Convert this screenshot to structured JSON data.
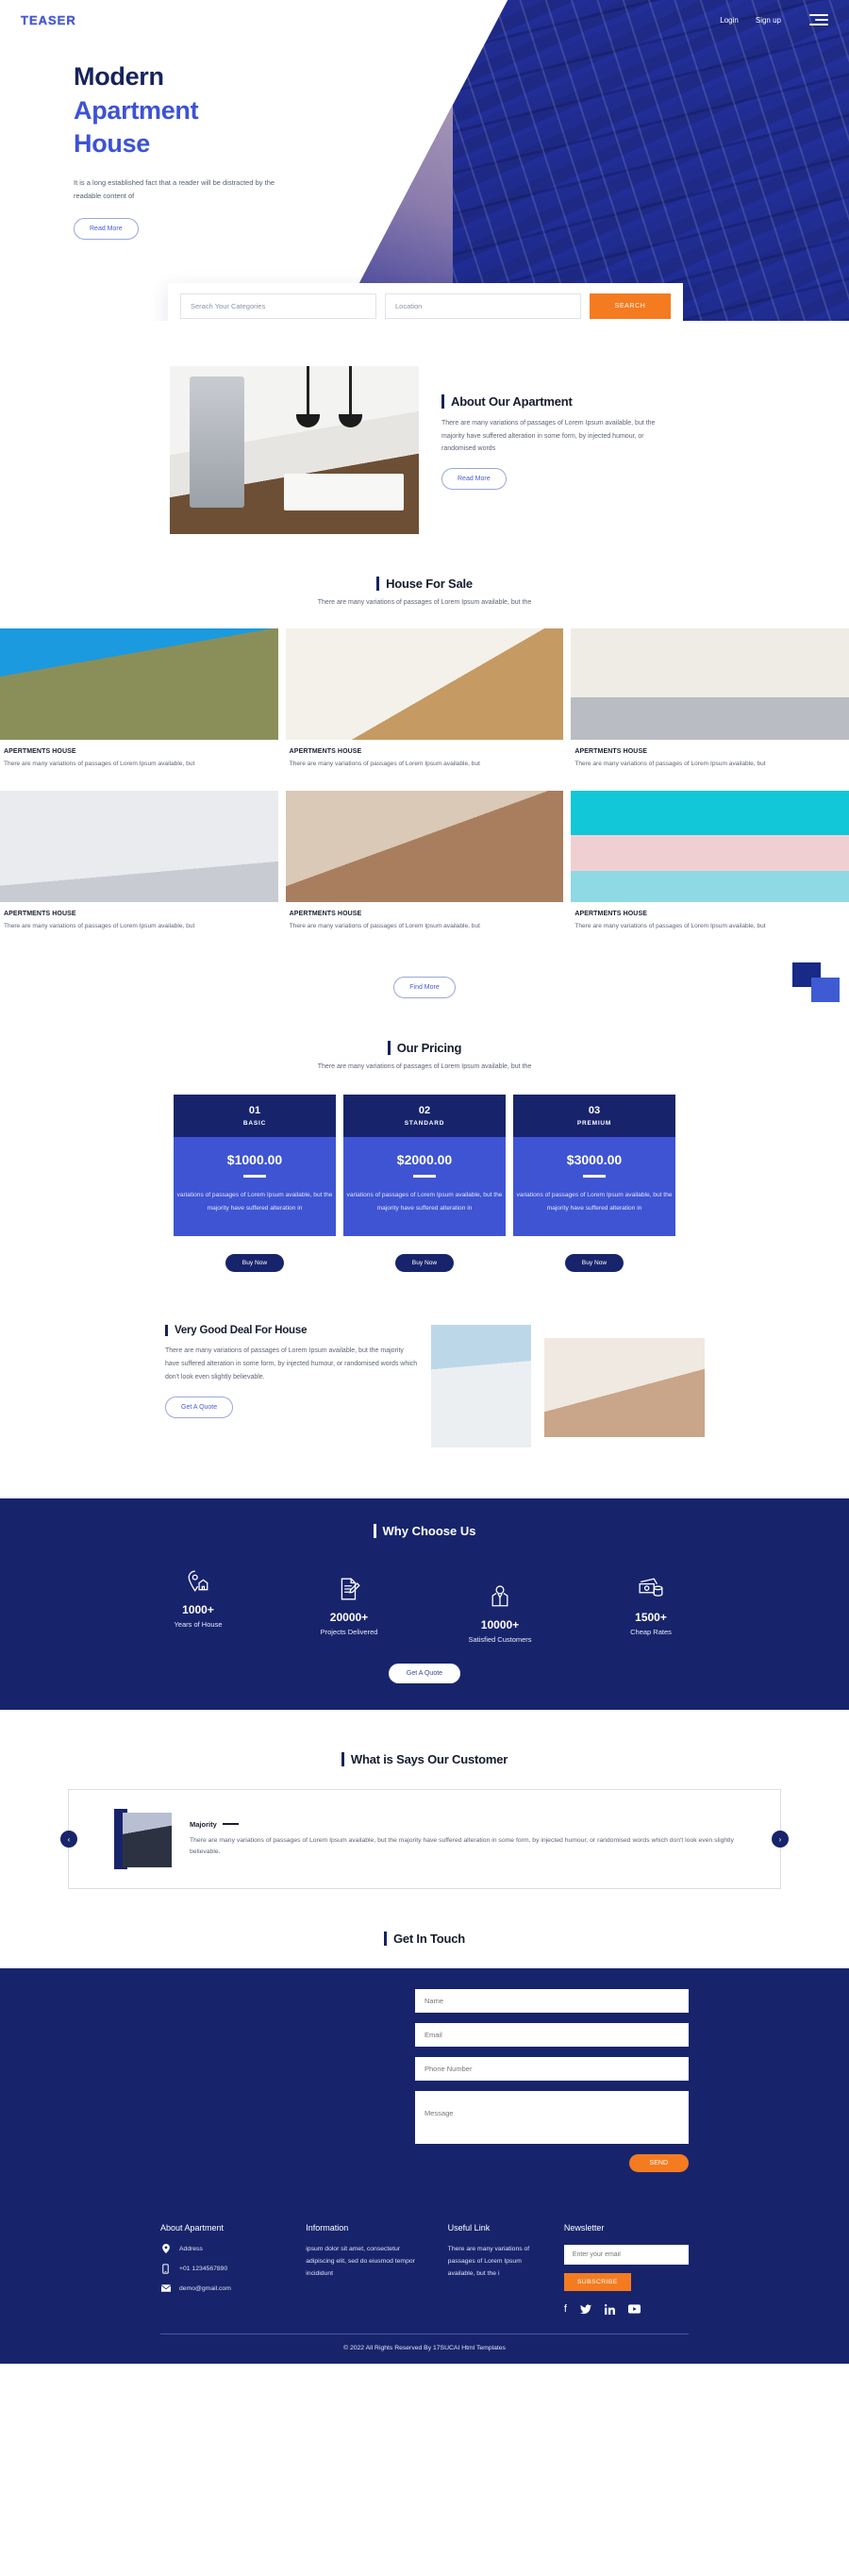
{
  "header": {
    "logo": "TEASER",
    "login": "Login",
    "signup": "Sign up"
  },
  "hero": {
    "title_line1": "Modern",
    "title_line2": "Apartment",
    "title_line3": "House",
    "paragraph": "It is a long established fact that a reader will be distracted by the readable content of",
    "cta": "Read More"
  },
  "search": {
    "category_placeholder": "Serach Your Categories",
    "location_placeholder": "Location",
    "button": "SEARCH"
  },
  "about": {
    "title": "About Our Apartment",
    "paragraph": "There are many variations of passages of Lorem Ipsum available, but the majority have suffered alteration in some form, by injected humour, or randomised words",
    "cta": "Read More"
  },
  "house_for_sale": {
    "title": "House For Sale",
    "subtitle": "There are many variations of passages of Lorem Ipsum available, but the",
    "cards": [
      {
        "title": "APERTMENTS HOUSE",
        "desc": "There are many variations of passages of Lorem Ipsum available, but"
      },
      {
        "title": "APERTMENTS HOUSE",
        "desc": "There are many variations of passages of Lorem Ipsum available, but"
      },
      {
        "title": "APERTMENTS HOUSE",
        "desc": "There are many variations of passages of Lorem Ipsum available, but"
      },
      {
        "title": "APERTMENTS HOUSE",
        "desc": "There are many variations of passages of Lorem Ipsum available, but"
      },
      {
        "title": "APERTMENTS HOUSE",
        "desc": "There are many variations of passages of Lorem Ipsum available, but"
      },
      {
        "title": "APERTMENTS HOUSE",
        "desc": "There are many variations of passages of Lorem Ipsum available, but"
      }
    ],
    "cta": "Find More"
  },
  "pricing": {
    "title": "Our Pricing",
    "subtitle": "There are many variations of passages of Lorem Ipsum available, but the",
    "plans": [
      {
        "number": "01",
        "name": "BASIC",
        "price": "$1000.00",
        "features": "variations of passages of Lorem Ipsum available, but the majority have suffered alteration in",
        "cta": "Buy Now"
      },
      {
        "number": "02",
        "name": "STANDARD",
        "price": "$2000.00",
        "features": "variations of passages of Lorem Ipsum available, but the majority have suffered alteration in",
        "cta": "Buy Now"
      },
      {
        "number": "03",
        "name": "PREMIUM",
        "price": "$3000.00",
        "features": "variations of passages of Lorem Ipsum available, but the majority have suffered alteration in",
        "cta": "Buy Now"
      }
    ]
  },
  "deal": {
    "title": "Very Good Deal For House",
    "paragraph": "There are many variations of passages of Lorem Ipsum available, but the majority have suffered alteration in some form, by injected humour, or randomised words which don't look even slightly believable.",
    "cta": "Get A Quote"
  },
  "why_choose": {
    "title": "Why Choose Us",
    "stats": [
      {
        "icon": "location-house-icon",
        "number": "1000+",
        "label": "Years of House"
      },
      {
        "icon": "document-edit-icon",
        "number": "20000+",
        "label": "Projects Delivered"
      },
      {
        "icon": "person-tie-icon",
        "number": "10000+",
        "label": "Satisfied Customers"
      },
      {
        "icon": "money-cash-icon",
        "number": "1500+",
        "label": "Cheap Rates"
      }
    ],
    "cta": "Get A Quote"
  },
  "testimonial": {
    "title": "What is Says Our Customer",
    "name": "Majority",
    "quote": "There are many variations of passages of Lorem Ipsum available, but the majority have suffered alteration in some form, by injected humour, or randomised words which don't look even slightly believable.",
    "prev": "‹",
    "next": "›"
  },
  "contact": {
    "title": "Get In Touch",
    "name_placeholder": "Name",
    "email_placeholder": "Email",
    "phone_placeholder": "Phone Number",
    "message_placeholder": "Message",
    "send": "SEND"
  },
  "footer": {
    "about": {
      "heading": "About Apartment",
      "address": "Address",
      "phone": "+01 1234567890",
      "email": "demo@gmail.com"
    },
    "information": {
      "heading": "Information",
      "text": "ipsum dolor sit amet, consectetur adipiscing elit, sed do eiusmod tempor incididunt"
    },
    "useful_link": {
      "heading": "Useful Link",
      "text": "There are many variations of passages of Lorem Ipsum available, but the i"
    },
    "newsletter": {
      "heading": "Newsletter",
      "placeholder": "Enter your email",
      "button": "SUBSCRIBE",
      "socials": [
        "facebook-icon",
        "twitter-icon",
        "linkedin-icon",
        "youtube-icon"
      ]
    },
    "copyright": "© 2022 All Rights Reserved By 17SUCAI Html Templates"
  },
  "colors": {
    "navy": "#17246c",
    "blue": "#3e54d3",
    "orange": "#f47b20"
  }
}
